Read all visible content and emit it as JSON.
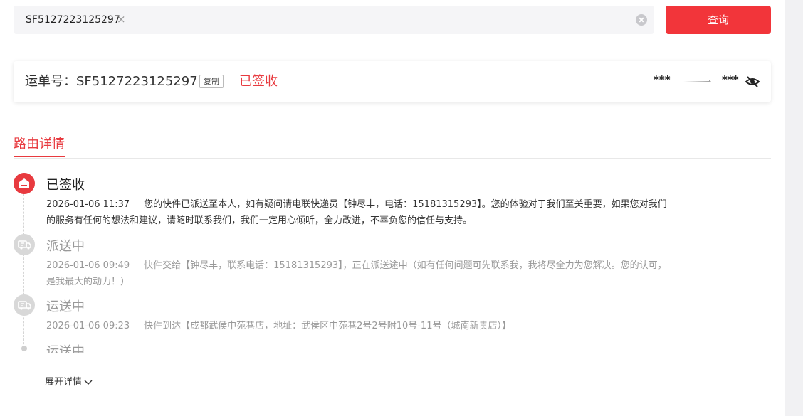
{
  "search": {
    "tag_value": "SF5127223125297",
    "tag_close": "×",
    "query_label": "查询"
  },
  "waybill": {
    "label": "运单号：SF5127223125297",
    "copy_label": "复制",
    "status": "已签收",
    "route_from": "***",
    "route_to": "***"
  },
  "tabs": {
    "route_details": "路由详情"
  },
  "timeline": [
    {
      "status": "已签收",
      "time": "2026-01-06 11:37",
      "text": "您的快件已派送至本人，如有疑问请电联快递员【钟尽丰，电话：15181315293】。您的体验对于我们至关重要，如果您对我们的服务有任何的想法和建议，请随时联系我们，我们一定用心倾听，全力改进，不辜负您的信任与支持。",
      "icon": "signed-house-icon"
    },
    {
      "status": "派送中",
      "time": "2026-01-06 09:49",
      "text": "快件交给【钟尽丰，联系电话：15181315293】，正在派送途中（如有任何问题可先联系我，我将尽全力为您解决。您的认可，是我最大的动力！）",
      "icon": "delivery-truck-icon"
    },
    {
      "status": "运送中",
      "time": "2026-01-06 09:23",
      "text": "快件到达【成都武侯中苑巷店，地址：武侯区中苑巷2号2号附10号-11号（城南新贵店）】",
      "icon": "transit-truck-icon"
    },
    {
      "status": "运送中"
    }
  ],
  "expand": {
    "label": "展开详情"
  },
  "colors": {
    "accent": "#e83a3f",
    "button": "#f2353a",
    "muted": "#999999"
  }
}
